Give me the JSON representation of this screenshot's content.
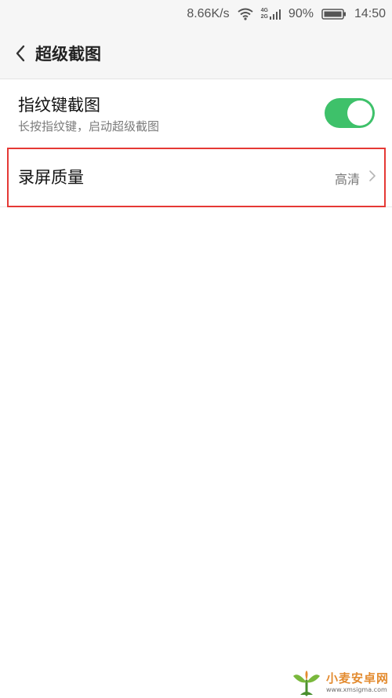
{
  "status_bar": {
    "speed": "8.66K/s",
    "network_top": "4G",
    "network_bottom": "2G",
    "battery": "90%",
    "time": "14:50"
  },
  "header": {
    "title": "超级截图"
  },
  "settings": {
    "fingerprint": {
      "title": "指纹键截图",
      "subtitle": "长按指纹键，启动超级截图",
      "enabled": true
    },
    "quality": {
      "label": "录屏质量",
      "value": "高清"
    }
  },
  "watermark": {
    "name": "小麦安卓网",
    "url": "www.xmsigma.com"
  },
  "colors": {
    "toggle_on": "#3ec16a",
    "highlight": "#e53935",
    "watermark": "#e38b2f"
  },
  "icons": {
    "wifi": "wifi-icon",
    "signal": "signal-icon",
    "battery": "battery-icon",
    "back": "back-icon",
    "chevron": "chevron-right-icon"
  }
}
